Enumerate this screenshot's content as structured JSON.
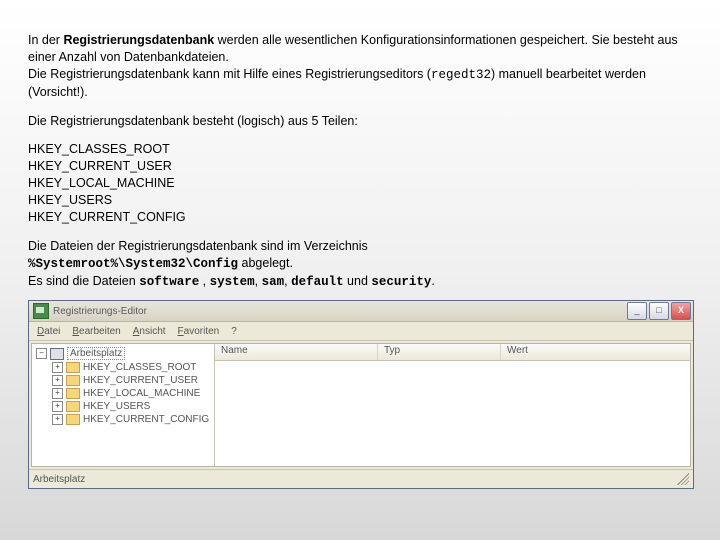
{
  "text": {
    "para1_a": "In der ",
    "para1_b": "Registrierungsdatenbank",
    "para1_c": " werden alle wesentlichen Konfigurationsinformationen gespeichert.  Sie besteht aus einer Anzahl von Datenbankdateien.",
    "para1_d": "Die Registrierungsdatenbank kann mit Hilfe eines Registrierungseditors (",
    "para1_e": "regedt32",
    "para1_f": ") manuell bearbeitet werden (Vorsicht!).",
    "para2": "Die Registrierungsdatenbank besteht (logisch) aus 5 Teilen:",
    "para3_a": "Die Dateien der Registrierungsdatenbank sind im Verzeichnis",
    "path": "%Systemroot%\\System32\\Config",
    "para3_b": " abgelegt.",
    "para3_c": "Es sind die Dateien ",
    "f1": "software",
    "sep_comma_sp": " , ",
    "f2": "system",
    "sep_comma": ", ",
    "f3": "sam",
    "f4": "default",
    "und": " und ",
    "f5": "security",
    "dot": "."
  },
  "keys": [
    "HKEY_CLASSES_ROOT",
    "HKEY_CURRENT_USER",
    "HKEY_LOCAL_MACHINE",
    "HKEY_USERS",
    "HKEY_CURRENT_CONFIG"
  ],
  "editor": {
    "title": "Registrierungs-Editor",
    "menu": {
      "datei": "Datei",
      "bearbeiten": "Bearbeiten",
      "ansicht": "Ansicht",
      "favoriten": "Favoriten",
      "help": "?"
    },
    "buttons": {
      "min": "_",
      "max": "□",
      "close": "X"
    },
    "tree": {
      "root": "Arbeitsplatz",
      "items": [
        "HKEY_CLASSES_ROOT",
        "HKEY_CURRENT_USER",
        "HKEY_LOCAL_MACHINE",
        "HKEY_USERS",
        "HKEY_CURRENT_CONFIG"
      ]
    },
    "columns": {
      "name": "Name",
      "type": "Typ",
      "wert": "Wert"
    },
    "status": "Arbeitsplatz",
    "expander_minus": "−",
    "expander_plus": "+"
  }
}
